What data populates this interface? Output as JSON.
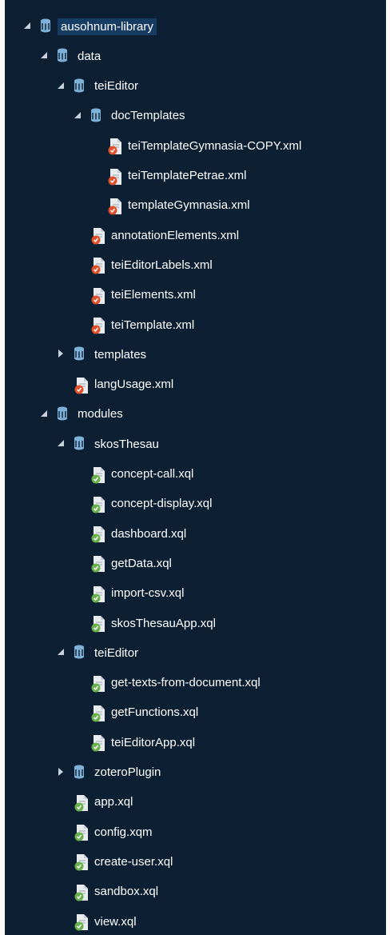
{
  "colors": {
    "panel_bg": "#0d2033",
    "selected_bg": "#163c64",
    "folder_icon": "#7fb1d8",
    "xml_badge": "#e0502a",
    "xql_badge": "#6ab04c"
  },
  "tree": [
    {
      "label": "ausohnum-library",
      "depth": 0,
      "kind": "folder",
      "expanded": true,
      "selected": true,
      "icon": "database-folder-icon"
    },
    {
      "label": "data",
      "depth": 1,
      "kind": "folder",
      "expanded": true,
      "icon": "database-folder-icon"
    },
    {
      "label": "teiEditor",
      "depth": 2,
      "kind": "folder",
      "expanded": true,
      "icon": "database-folder-icon"
    },
    {
      "label": "docTemplates",
      "depth": 3,
      "kind": "folder",
      "expanded": true,
      "icon": "database-folder-icon"
    },
    {
      "label": "teiTemplateGymnasia-COPY.xml",
      "depth": 4,
      "kind": "xml",
      "icon": "xml-file-icon"
    },
    {
      "label": "teiTemplatePetrae.xml",
      "depth": 4,
      "kind": "xml",
      "icon": "xml-file-icon"
    },
    {
      "label": "templateGymnasia.xml",
      "depth": 4,
      "kind": "xml",
      "icon": "xml-file-icon"
    },
    {
      "label": "annotationElements.xml",
      "depth": 3,
      "kind": "xml",
      "icon": "xml-file-icon"
    },
    {
      "label": "teiEditorLabels.xml",
      "depth": 3,
      "kind": "xml",
      "icon": "xml-file-icon"
    },
    {
      "label": "teiElements.xml",
      "depth": 3,
      "kind": "xml",
      "icon": "xml-file-icon"
    },
    {
      "label": "teiTemplate.xml",
      "depth": 3,
      "kind": "xml",
      "icon": "xml-file-icon"
    },
    {
      "label": "templates",
      "depth": 2,
      "kind": "folder",
      "expanded": false,
      "icon": "database-folder-icon"
    },
    {
      "label": "langUsage.xml",
      "depth": 2,
      "kind": "xml",
      "icon": "xml-file-icon"
    },
    {
      "label": "modules",
      "depth": 1,
      "kind": "folder",
      "expanded": true,
      "icon": "database-folder-icon"
    },
    {
      "label": "skosThesau",
      "depth": 2,
      "kind": "folder",
      "expanded": true,
      "icon": "database-folder-icon"
    },
    {
      "label": "concept-call.xql",
      "depth": 3,
      "kind": "xql",
      "icon": "xquery-file-icon"
    },
    {
      "label": "concept-display.xql",
      "depth": 3,
      "kind": "xql",
      "icon": "xquery-file-icon"
    },
    {
      "label": "dashboard.xql",
      "depth": 3,
      "kind": "xql",
      "icon": "xquery-file-icon"
    },
    {
      "label": "getData.xql",
      "depth": 3,
      "kind": "xql",
      "icon": "xquery-file-icon"
    },
    {
      "label": "import-csv.xql",
      "depth": 3,
      "kind": "xql",
      "icon": "xquery-file-icon"
    },
    {
      "label": "skosThesauApp.xql",
      "depth": 3,
      "kind": "xql",
      "icon": "xquery-file-icon"
    },
    {
      "label": "teiEditor",
      "depth": 2,
      "kind": "folder",
      "expanded": true,
      "icon": "database-folder-icon"
    },
    {
      "label": "get-texts-from-document.xql",
      "depth": 3,
      "kind": "xql",
      "icon": "xquery-file-icon"
    },
    {
      "label": "getFunctions.xql",
      "depth": 3,
      "kind": "xql",
      "icon": "xquery-file-icon"
    },
    {
      "label": "teiEditorApp.xql",
      "depth": 3,
      "kind": "xql",
      "icon": "xquery-file-icon"
    },
    {
      "label": "zoteroPlugin",
      "depth": 2,
      "kind": "folder",
      "expanded": false,
      "icon": "database-folder-icon"
    },
    {
      "label": "app.xql",
      "depth": 2,
      "kind": "xql",
      "icon": "xquery-file-icon"
    },
    {
      "label": "config.xqm",
      "depth": 2,
      "kind": "xql",
      "icon": "xquery-file-icon"
    },
    {
      "label": "create-user.xql",
      "depth": 2,
      "kind": "xql",
      "icon": "xquery-file-icon"
    },
    {
      "label": "sandbox.xql",
      "depth": 2,
      "kind": "xql",
      "icon": "xquery-file-icon"
    },
    {
      "label": "view.xql",
      "depth": 2,
      "kind": "xql",
      "icon": "xquery-file-icon"
    }
  ]
}
